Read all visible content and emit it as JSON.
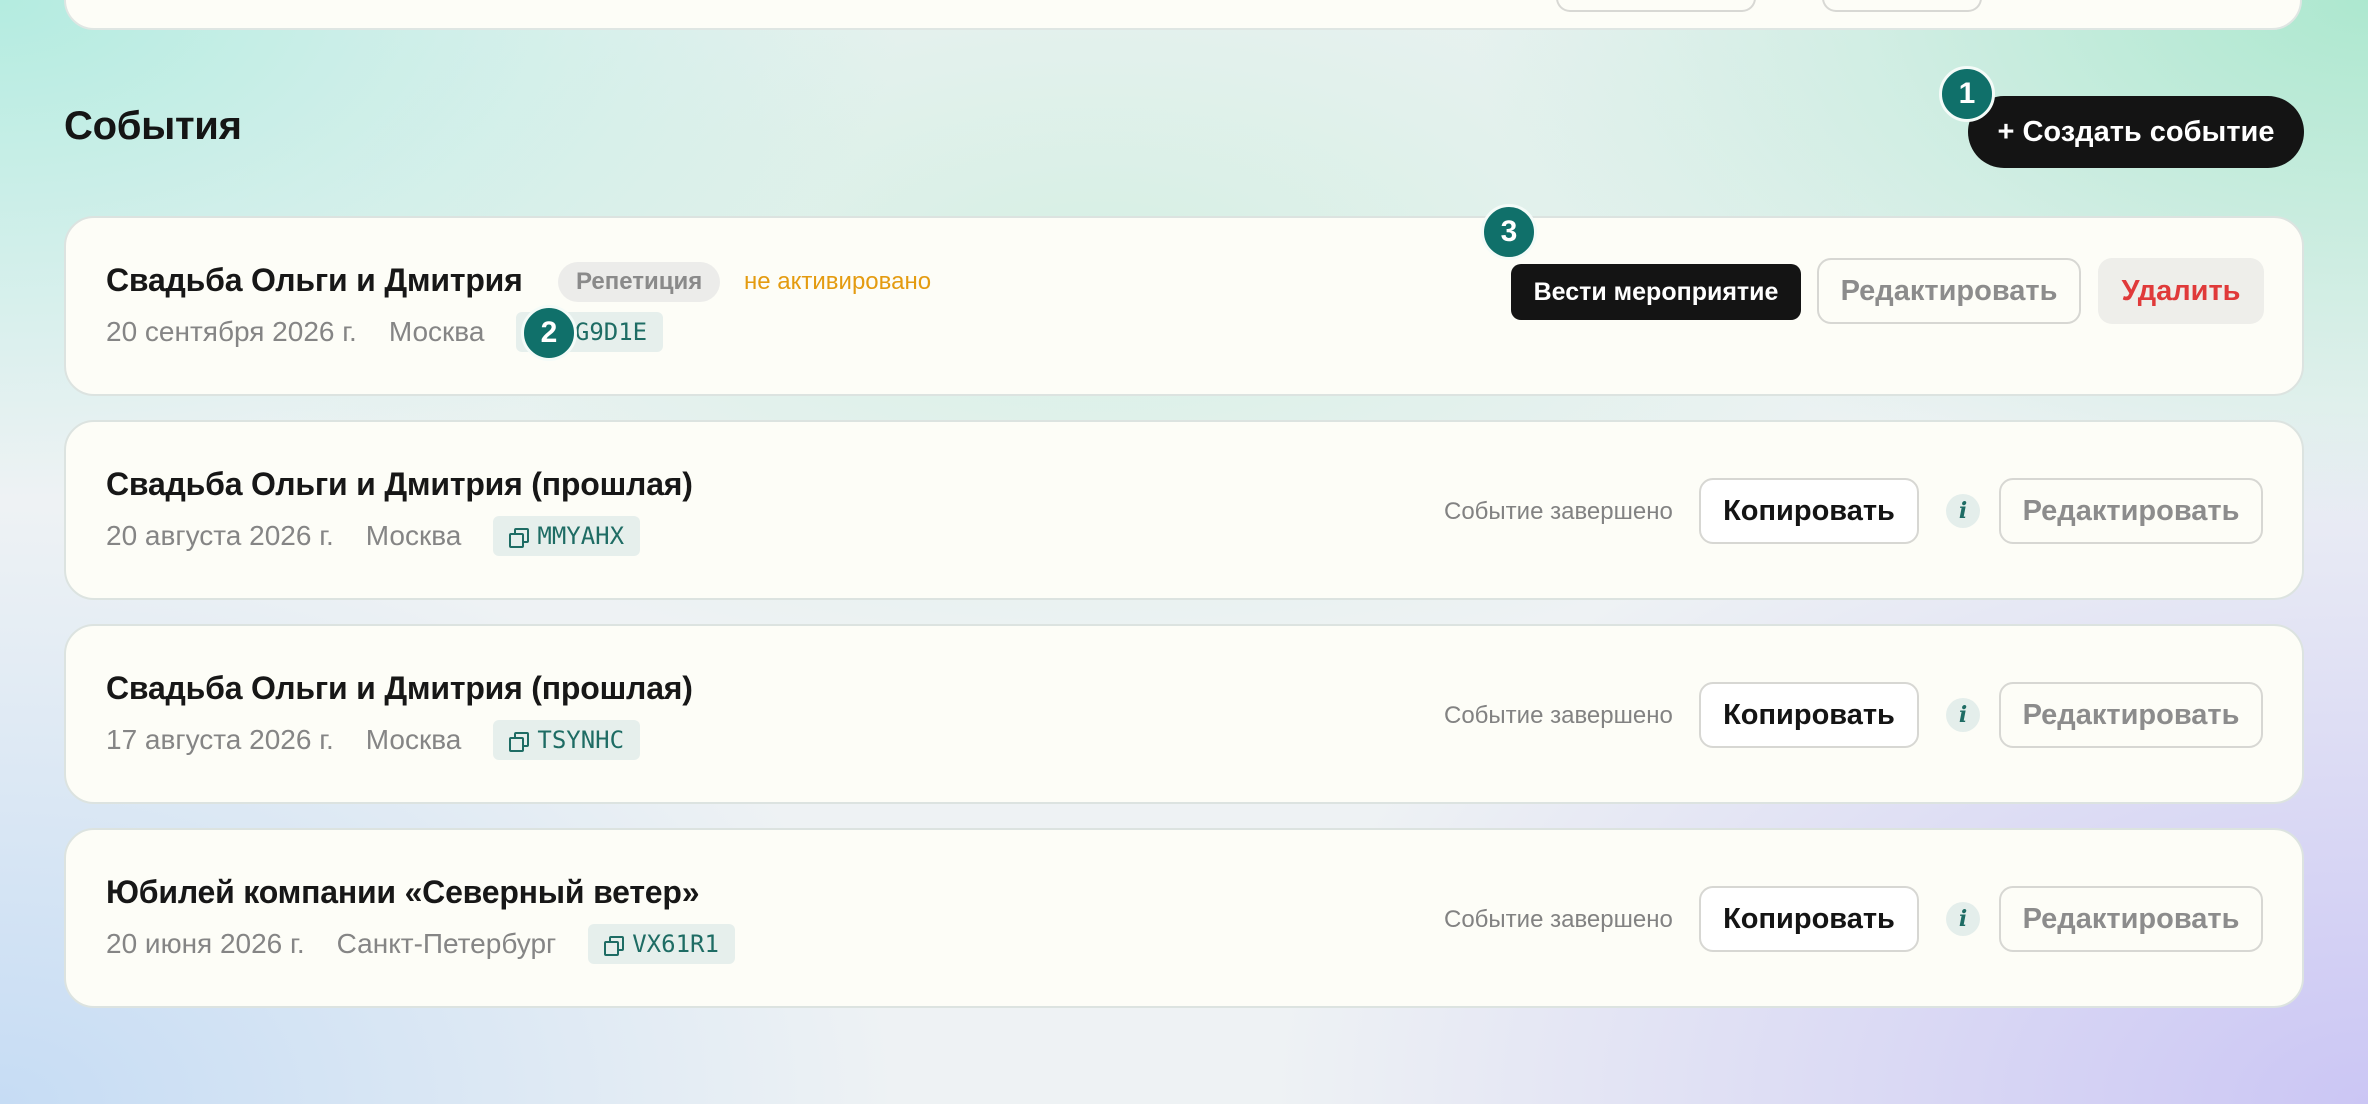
{
  "header": {
    "section_title": "События",
    "create_button_label": "+ Создать событие"
  },
  "markers": {
    "m1": "1",
    "m2": "2",
    "m3": "3"
  },
  "events": [
    {
      "title": "Свадьба Ольги и Дмитрия",
      "badge": "Репетиция",
      "status": "не активировано",
      "date": "20 сентября 2026 г.",
      "city": "Москва",
      "code": "YG9D1E",
      "actions": {
        "run": "Вести мероприятие",
        "edit": "Редактировать",
        "delete": "Удалить"
      }
    },
    {
      "title": "Свадьба Ольги и Дмитрия (прошлая)",
      "date": "20 августа 2026 г.",
      "city": "Москва",
      "code": "MMYAHX",
      "finished": "Событие завершено",
      "actions": {
        "copy": "Копировать",
        "info": "i",
        "edit": "Редактировать"
      }
    },
    {
      "title": "Свадьба Ольги и Дмитрия (прошлая)",
      "date": "17 августа 2026 г.",
      "city": "Москва",
      "code": "TSYNHC",
      "finished": "Событие завершено",
      "actions": {
        "copy": "Копировать",
        "info": "i",
        "edit": "Редактировать"
      }
    },
    {
      "title": "Юбилей компании «Северный ветер»",
      "date": "20 июня 2026 г.",
      "city": "Санкт-Петербург",
      "code": "VX61R1",
      "finished": "Событие завершено",
      "actions": {
        "copy": "Копировать",
        "info": "i",
        "edit": "Редактировать"
      }
    }
  ],
  "colors": {
    "accent_teal": "#10706a",
    "dark_button": "#141414",
    "danger": "#e03a3a",
    "warning": "#e49b10",
    "card_bg": "#fdfdf7"
  }
}
